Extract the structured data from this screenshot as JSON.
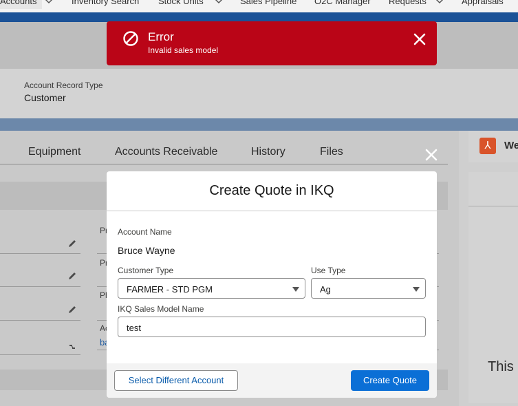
{
  "nav": {
    "items": [
      "Accounts",
      "Inventory Search",
      "Stock Units",
      "Sales Pipeline",
      "O2C Manager",
      "Requests",
      "Appraisals"
    ]
  },
  "record": {
    "record_type_label": "Account Record Type",
    "record_type_value": "Customer"
  },
  "tabs": [
    "Equipment",
    "Accounts Receivable",
    "History",
    "Files"
  ],
  "details": {
    "labels": [
      "Pr",
      "Pr",
      "Ph",
      "Ac"
    ],
    "link_fragment": "ba"
  },
  "right_panel": {
    "title_fragment": "We",
    "body_fragment": "This a"
  },
  "toast": {
    "title": "Error",
    "message": "Invalid sales model"
  },
  "modal": {
    "title": "Create Quote in IKQ",
    "account_name_label": "Account Name",
    "account_name_value": "Bruce Wayne",
    "customer_type_label": "Customer Type",
    "customer_type_value": "FARMER - STD PGM",
    "use_type_label": "Use Type",
    "use_type_value": "Ag",
    "sales_model_label": "IKQ Sales Model Name",
    "sales_model_value": "test",
    "select_account_button": "Select Different Account",
    "create_quote_button": "Create Quote"
  },
  "colors": {
    "error_toast": "#ba0517",
    "brand_button": "#0b6fd6",
    "nav_band": "#1b5297"
  }
}
